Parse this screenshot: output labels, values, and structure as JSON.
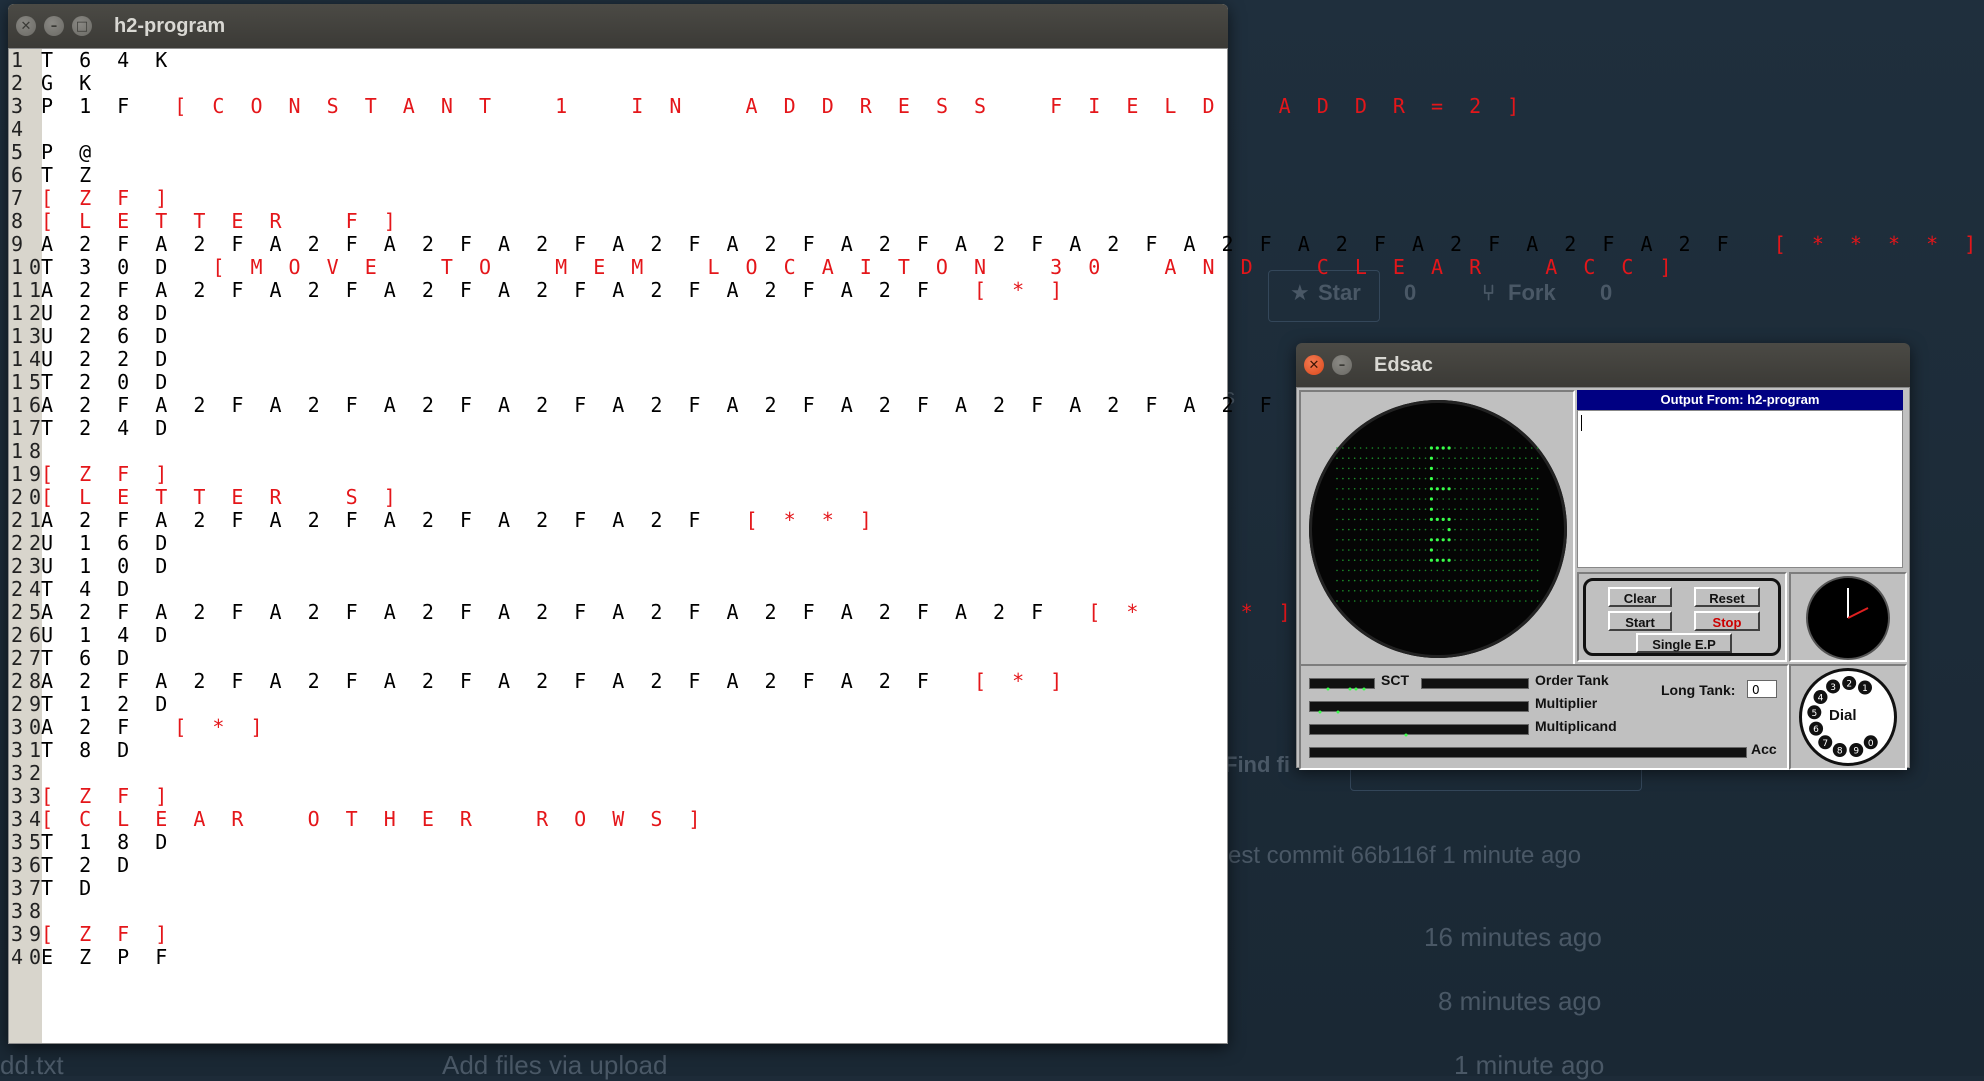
{
  "editor": {
    "title": "h2-program",
    "lines": [
      {
        "n": "1",
        "code": "T 6 4 K",
        "comment": ""
      },
      {
        "n": "2",
        "code": "G K",
        "comment": ""
      },
      {
        "n": "3",
        "code": "P 1 F  ",
        "comment": "[ C O N S T A N T   1   I N   A D D R E S S   F I E L D   A D D R = 2 ]"
      },
      {
        "n": "4",
        "code": "",
        "comment": ""
      },
      {
        "n": "5",
        "code": "P @",
        "comment": ""
      },
      {
        "n": "6",
        "code": "T Z",
        "comment": ""
      },
      {
        "n": "7",
        "code": "",
        "comment": "[ Z F ]"
      },
      {
        "n": "8",
        "code": "",
        "comment": "[ L E T T E R   F ]"
      },
      {
        "n": "9",
        "code": "A 2 F A 2 F A 2 F A 2 F A 2 F A 2 F A 2 F A 2 F A 2 F A 2 F A 2 F A 2 F A 2 F A 2 F A 2 F  ",
        "comment": "[ * * * * ]"
      },
      {
        "n": "10",
        "code": "T 3 0 D  ",
        "comment": "[ M O V E   T O   M E M   L O C A I T O N   3 0   A N D   C L E A R   A C C ]"
      },
      {
        "n": "11",
        "code": "A 2 F A 2 F A 2 F A 2 F A 2 F A 2 F A 2 F A 2 F  ",
        "comment": "[ * ]"
      },
      {
        "n": "12",
        "code": "U 2 8 D",
        "comment": ""
      },
      {
        "n": "13",
        "code": "U 2 6 D",
        "comment": ""
      },
      {
        "n": "14",
        "code": "U 2 2 D",
        "comment": ""
      },
      {
        "n": "15",
        "code": "T 2 0 D",
        "comment": ""
      },
      {
        "n": "16",
        "code": "A 2 F A 2 F A 2 F A 2 F A 2 F A 2 F A 2 F A 2 F A 2 F A 2 F A 2 F A 2 F A 2 F A 2 F  ",
        "comment": "[ * * * ]"
      },
      {
        "n": "17",
        "code": "T 2 4 D",
        "comment": ""
      },
      {
        "n": "18",
        "code": "",
        "comment": ""
      },
      {
        "n": "19",
        "code": "",
        "comment": "[ Z F ]"
      },
      {
        "n": "20",
        "code": "",
        "comment": "[ L E T T E R   S ]"
      },
      {
        "n": "21",
        "code": "A 2 F A 2 F A 2 F A 2 F A 2 F A 2 F  ",
        "comment": "[ * * ]"
      },
      {
        "n": "22",
        "code": "U 1 6 D",
        "comment": ""
      },
      {
        "n": "23",
        "code": "U 1 0 D",
        "comment": ""
      },
      {
        "n": "24",
        "code": "T 4 D",
        "comment": ""
      },
      {
        "n": "25",
        "code": "A 2 F A 2 F A 2 F A 2 F A 2 F A 2 F A 2 F A 2 F A 2 F  ",
        "comment": "[ *     * ]"
      },
      {
        "n": "26",
        "code": "U 1 4 D",
        "comment": ""
      },
      {
        "n": "27",
        "code": "T 6 D",
        "comment": ""
      },
      {
        "n": "28",
        "code": "A 2 F A 2 F A 2 F A 2 F A 2 F A 2 F A 2 F A 2 F  ",
        "comment": "[ * ]"
      },
      {
        "n": "29",
        "code": "T 1 2 D",
        "comment": ""
      },
      {
        "n": "30",
        "code": "A 2 F  ",
        "comment": "[ * ]"
      },
      {
        "n": "31",
        "code": "T 8 D",
        "comment": ""
      },
      {
        "n": "32",
        "code": "",
        "comment": ""
      },
      {
        "n": "33",
        "code": "",
        "comment": "[ Z F ]"
      },
      {
        "n": "34",
        "code": "",
        "comment": "[ C L E A R   O T H E R   R O W S ]"
      },
      {
        "n": "35",
        "code": "T 1 8 D",
        "comment": ""
      },
      {
        "n": "36",
        "code": "T 2 D",
        "comment": ""
      },
      {
        "n": "37",
        "code": "T D",
        "comment": ""
      },
      {
        "n": "38",
        "code": "",
        "comment": ""
      },
      {
        "n": "39",
        "code": "",
        "comment": "[ Z F ]"
      },
      {
        "n": "40",
        "code": "E Z P F",
        "comment": ""
      }
    ]
  },
  "edsac": {
    "title": "Edsac",
    "output_header": "Output From: h2-program",
    "output_text": "",
    "buttons": {
      "clear": "Clear",
      "reset": "Reset",
      "start": "Start",
      "stop": "Stop",
      "single": "Single E.P"
    },
    "labels": {
      "sct": "SCT",
      "order_tank": "Order Tank",
      "multiplier": "Multiplier",
      "multiplicand": "Multiplicand",
      "acc": "Acc",
      "long_tank": "Long Tank:"
    },
    "long_tank_value": "0",
    "dial_label": "Dial",
    "dial_digits": [
      "1",
      "2",
      "3",
      "4",
      "5",
      "6",
      "7",
      "8",
      "9",
      "0"
    ],
    "colors": {
      "crt_dot": "#1c8f2a",
      "crt_lit": "#39ff4a",
      "stop_text": "#cc0000",
      "output_header_bg": "#000082"
    }
  },
  "background": {
    "star": "Star",
    "star_count": "0",
    "fork": "Fork",
    "fork_count": "0",
    "find_file": "Find fi",
    "latest_commit": "est commit 66b116f  1 minute ago",
    "time1": "16 minutes ago",
    "time2": "8 minutes ago",
    "time3": "1 minute ago",
    "add_files": "Add files via upload",
    "file_stub": "dd.txt",
    "stub_s": "s"
  }
}
